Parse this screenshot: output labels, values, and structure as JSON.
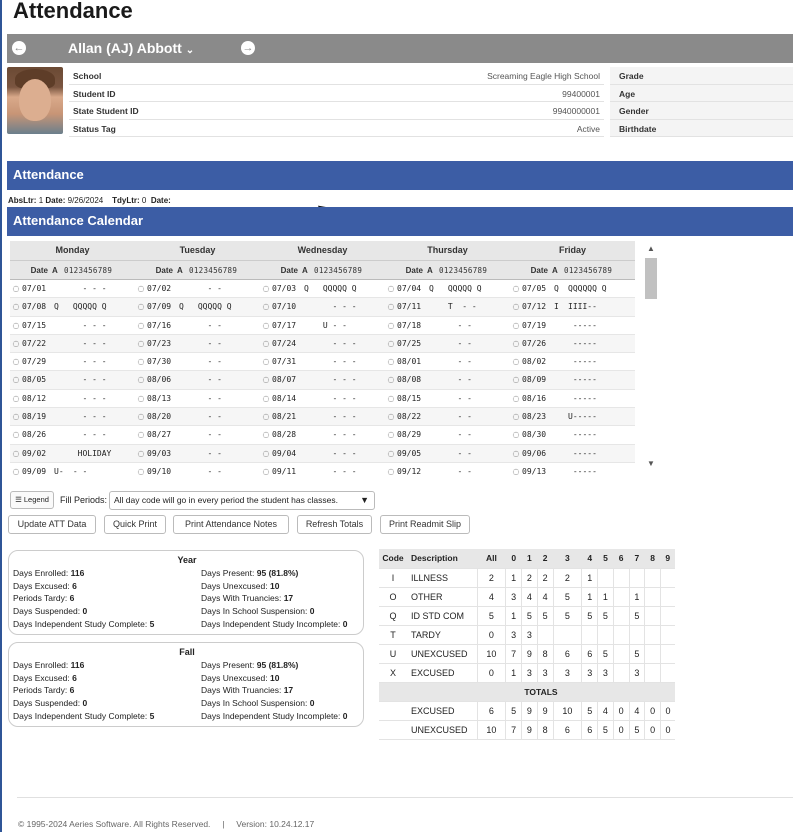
{
  "page": {
    "title": "Attendance"
  },
  "student": {
    "name": "Allan (AJ) Abbott",
    "fields_left": [
      {
        "label": "School",
        "value": "Screaming Eagle High School"
      },
      {
        "label": "Student ID",
        "value": "99400001"
      },
      {
        "label": "State Student ID",
        "value": "9940000001"
      },
      {
        "label": "Status Tag",
        "value": "Active"
      }
    ],
    "fields_right": [
      {
        "label": "Grade",
        "value": ""
      },
      {
        "label": "Age",
        "value": ""
      },
      {
        "label": "Gender",
        "value": ""
      },
      {
        "label": "Birthdate",
        "value": ""
      }
    ]
  },
  "attendance_section": {
    "title": "Attendance"
  },
  "absltr": {
    "abs_label": "AbsLtr:",
    "abs_value": "1",
    "date_label": "Date:",
    "date_value": "9/26/2024",
    "tdy_label": "TdyLtr:",
    "tdy_value": "0",
    "date2_label": "Date:"
  },
  "calendar_section": {
    "title": "Attendance Calendar"
  },
  "calendar": {
    "days": [
      "Monday",
      "Tuesday",
      "Wednesday",
      "Thursday",
      "Friday"
    ],
    "col_date": "Date",
    "col_a": "A",
    "col_periods": "0123456789",
    "rows": [
      [
        {
          "d": "07/01",
          "a": "",
          "p": "   - - -"
        },
        {
          "d": "07/02",
          "a": "",
          "p": "   - -"
        },
        {
          "d": "07/03",
          "a": "Q",
          "p": " QQQQQ Q"
        },
        {
          "d": "07/04",
          "a": "Q",
          "p": " QQQQQ Q"
        },
        {
          "d": "07/05",
          "a": "Q",
          "p": "QQQQQQ Q"
        }
      ],
      [
        {
          "d": "07/08",
          "a": "Q",
          "p": " QQQQQ Q"
        },
        {
          "d": "07/09",
          "a": "Q",
          "p": " QQQQQ Q"
        },
        {
          "d": "07/10",
          "a": "",
          "p": "   - - -"
        },
        {
          "d": "07/11",
          "a": "",
          "p": " T  - -"
        },
        {
          "d": "07/12",
          "a": "I",
          "p": "IIII--"
        }
      ],
      [
        {
          "d": "07/15",
          "a": "",
          "p": "   - - -"
        },
        {
          "d": "07/16",
          "a": "",
          "p": "   - -"
        },
        {
          "d": "07/17",
          "a": "",
          "p": " U - -"
        },
        {
          "d": "07/18",
          "a": "",
          "p": "   - -"
        },
        {
          "d": "07/19",
          "a": "",
          "p": " -----"
        }
      ],
      [
        {
          "d": "07/22",
          "a": "",
          "p": "   - - -"
        },
        {
          "d": "07/23",
          "a": "",
          "p": "   - -"
        },
        {
          "d": "07/24",
          "a": "",
          "p": "   - - -"
        },
        {
          "d": "07/25",
          "a": "",
          "p": "   - -"
        },
        {
          "d": "07/26",
          "a": "",
          "p": " -----"
        }
      ],
      [
        {
          "d": "07/29",
          "a": "",
          "p": "   - - -"
        },
        {
          "d": "07/30",
          "a": "",
          "p": "   - -"
        },
        {
          "d": "07/31",
          "a": "",
          "p": "   - - -"
        },
        {
          "d": "08/01",
          "a": "",
          "p": "   - -"
        },
        {
          "d": "08/02",
          "a": "",
          "p": " -----"
        }
      ],
      [
        {
          "d": "08/05",
          "a": "",
          "p": "   - - -"
        },
        {
          "d": "08/06",
          "a": "",
          "p": "   - -"
        },
        {
          "d": "08/07",
          "a": "",
          "p": "   - - -"
        },
        {
          "d": "08/08",
          "a": "",
          "p": "   - -"
        },
        {
          "d": "08/09",
          "a": "",
          "p": " -----"
        }
      ],
      [
        {
          "d": "08/12",
          "a": "",
          "p": "   - - -"
        },
        {
          "d": "08/13",
          "a": "",
          "p": "   - -"
        },
        {
          "d": "08/14",
          "a": "",
          "p": "   - - -"
        },
        {
          "d": "08/15",
          "a": "",
          "p": "   - -"
        },
        {
          "d": "08/16",
          "a": "",
          "p": " -----"
        }
      ],
      [
        {
          "d": "08/19",
          "a": "",
          "p": "   - - -"
        },
        {
          "d": "08/20",
          "a": "",
          "p": "   - -"
        },
        {
          "d": "08/21",
          "a": "",
          "p": "   - - -"
        },
        {
          "d": "08/22",
          "a": "",
          "p": "   - -"
        },
        {
          "d": "08/23",
          "a": "",
          "p": "U-----"
        }
      ],
      [
        {
          "d": "08/26",
          "a": "",
          "p": "   - - -"
        },
        {
          "d": "08/27",
          "a": "",
          "p": "   - -"
        },
        {
          "d": "08/28",
          "a": "",
          "p": "   - - -"
        },
        {
          "d": "08/29",
          "a": "",
          "p": "   - -"
        },
        {
          "d": "08/30",
          "a": "",
          "p": " -----"
        }
      ],
      [
        {
          "d": "09/02",
          "a": "",
          "p": "  HOLIDAY"
        },
        {
          "d": "09/03",
          "a": "",
          "p": "   - -"
        },
        {
          "d": "09/04",
          "a": "",
          "p": "   - - -"
        },
        {
          "d": "09/05",
          "a": "",
          "p": "   - -"
        },
        {
          "d": "09/06",
          "a": "",
          "p": " -----"
        }
      ],
      [
        {
          "d": "09/09",
          "a": "U-",
          "p": " - -"
        },
        {
          "d": "09/10",
          "a": "",
          "p": "   - -"
        },
        {
          "d": "09/11",
          "a": "",
          "p": "   - - -"
        },
        {
          "d": "09/12",
          "a": "",
          "p": "   - -"
        },
        {
          "d": "09/13",
          "a": "",
          "p": " -----"
        }
      ]
    ]
  },
  "controls": {
    "legend_label": "Legend",
    "fill_periods_label": "Fill Periods:",
    "fill_periods_value": "All day code will go in every period the student has classes.",
    "buttons": [
      "Update ATT Data",
      "Quick Print",
      "Print Attendance Notes",
      "Refresh Totals",
      "Print Readmit Slip"
    ]
  },
  "stats": {
    "year": {
      "title": "Year",
      "left": [
        {
          "label": "Days Enrolled:",
          "value": "116"
        },
        {
          "label": "Days Excused:",
          "value": "6"
        },
        {
          "label": "Periods Tardy:",
          "value": "6"
        },
        {
          "label": "Days Suspended:",
          "value": "0"
        },
        {
          "label": "Days Independent Study Complete:",
          "value": "5"
        }
      ],
      "right": [
        {
          "label": "Days Present:",
          "value": "95 (81.8%)"
        },
        {
          "label": "Days Unexcused:",
          "value": "10"
        },
        {
          "label": "Days With Truancies:",
          "value": "17"
        },
        {
          "label": "Days In School Suspension:",
          "value": "0"
        },
        {
          "label": "Days Independent Study Incomplete:",
          "value": "0"
        }
      ]
    },
    "fall": {
      "title": "Fall",
      "left": [
        {
          "label": "Days Enrolled:",
          "value": "116"
        },
        {
          "label": "Days Excused:",
          "value": "6"
        },
        {
          "label": "Periods Tardy:",
          "value": "6"
        },
        {
          "label": "Days Suspended:",
          "value": "0"
        },
        {
          "label": "Days Independent Study Complete:",
          "value": "5"
        }
      ],
      "right": [
        {
          "label": "Days Present:",
          "value": "95 (81.8%)"
        },
        {
          "label": "Days Unexcused:",
          "value": "10"
        },
        {
          "label": "Days With Truancies:",
          "value": "17"
        },
        {
          "label": "Days In School Suspension:",
          "value": "0"
        },
        {
          "label": "Days Independent Study Incomplete:",
          "value": "0"
        }
      ]
    }
  },
  "codes": {
    "headers": [
      "Code",
      "Description",
      "All",
      "0",
      "1",
      "2",
      "3",
      "4",
      "5",
      "6",
      "7",
      "8",
      "9"
    ],
    "rows": [
      [
        "I",
        "ILLNESS",
        "2",
        "1",
        "2",
        "2",
        "2",
        "1",
        "",
        "",
        "",
        "",
        ""
      ],
      [
        "O",
        "OTHER",
        "4",
        "3",
        "4",
        "4",
        "5",
        "1",
        "1",
        "",
        "1",
        "",
        ""
      ],
      [
        "Q",
        "ID STD COM",
        "5",
        "1",
        "5",
        "5",
        "5",
        "5",
        "5",
        "",
        "5",
        "",
        ""
      ],
      [
        "T",
        "TARDY",
        "0",
        "3",
        "3",
        "",
        "",
        "",
        "",
        "",
        "",
        "",
        ""
      ],
      [
        "U",
        "UNEXCUSED",
        "10",
        "7",
        "9",
        "8",
        "6",
        "6",
        "5",
        "",
        "5",
        "",
        ""
      ],
      [
        "X",
        "EXCUSED",
        "0",
        "1",
        "3",
        "3",
        "3",
        "3",
        "3",
        "",
        "3",
        "",
        ""
      ]
    ],
    "totals_label": "TOTALS",
    "totals": [
      [
        "",
        "EXCUSED",
        "6",
        "5",
        "9",
        "9",
        "10",
        "5",
        "4",
        "0",
        "4",
        "0",
        "0"
      ],
      [
        "",
        "UNEXCUSED",
        "10",
        "7",
        "9",
        "8",
        "6",
        "6",
        "5",
        "0",
        "5",
        "0",
        "0"
      ]
    ]
  },
  "footer": {
    "copyright": "© 1995-2024 Aeries Software. All Rights Reserved.",
    "sep": "|",
    "version": "Version: 10.24.12.17"
  }
}
